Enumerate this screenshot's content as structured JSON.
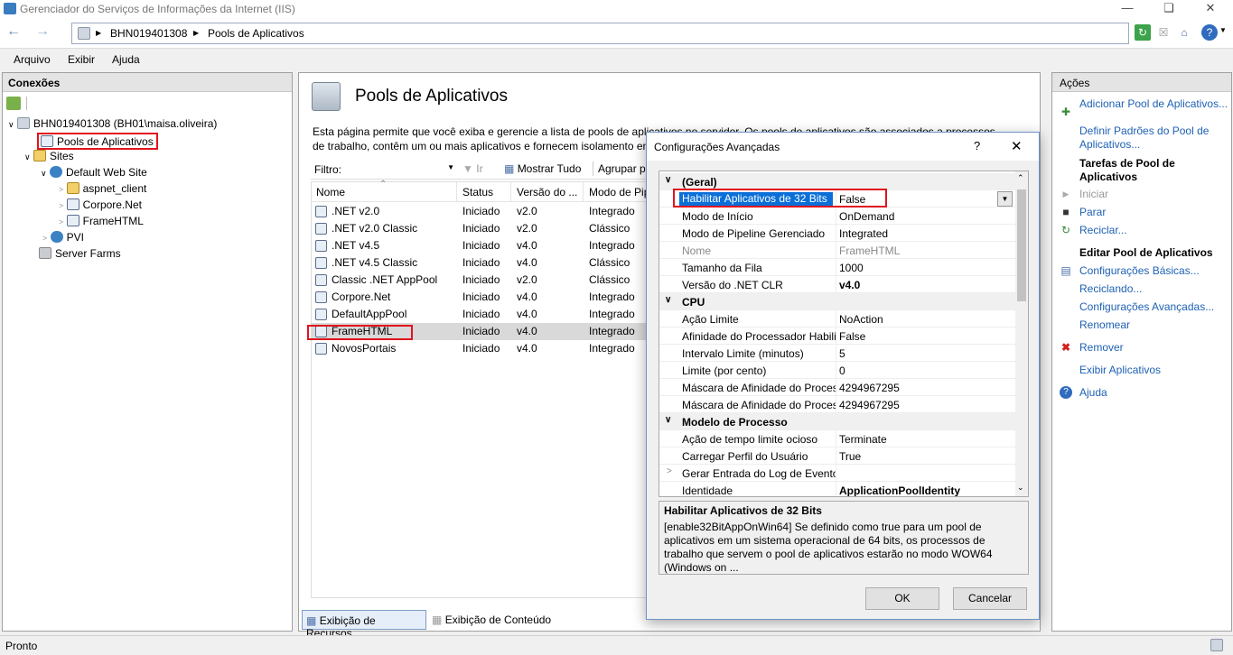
{
  "window": {
    "title": "Gerenciador do Serviços de Informações da Internet (IIS)"
  },
  "address": {
    "server": "BHN019401308",
    "page": "Pools de Aplicativos"
  },
  "menu": [
    "Arquivo",
    "Exibir",
    "Ajuda"
  ],
  "connections": {
    "title": "Conexões",
    "tree": [
      {
        "label": "BHN019401308 (BH01\\maisa.oliveira)"
      },
      {
        "label": "Pools de Aplicativos"
      },
      {
        "label": "Sites"
      },
      {
        "label": "Default Web Site"
      },
      {
        "label": "aspnet_client"
      },
      {
        "label": "Corpore.Net"
      },
      {
        "label": "FrameHTML"
      },
      {
        "label": "PVI"
      },
      {
        "label": "Server Farms"
      }
    ]
  },
  "main": {
    "heading": "Pools de Aplicativos",
    "description": "Esta página permite que você exiba e gerencie a lista de pools de aplicativos no servidor. Os pools de aplicativos são associados a processos de trabalho, contêm um ou mais aplicativos e fornecem isolamento entre",
    "filter_label": "Filtro:",
    "go_label": "Ir",
    "show_all_label": "Mostrar Tudo",
    "group_label": "Agrupar po",
    "columns": [
      "Nome",
      "Status",
      "Versão do ...",
      "Modo de Pip"
    ],
    "rows": [
      {
        "name": ".NET v2.0",
        "status": "Iniciado",
        "version": "v2.0",
        "mode": "Integrado"
      },
      {
        "name": ".NET v2.0 Classic",
        "status": "Iniciado",
        "version": "v2.0",
        "mode": "Clássico"
      },
      {
        "name": ".NET v4.5",
        "status": "Iniciado",
        "version": "v4.0",
        "mode": "Integrado"
      },
      {
        "name": ".NET v4.5 Classic",
        "status": "Iniciado",
        "version": "v4.0",
        "mode": "Clássico"
      },
      {
        "name": "Classic .NET AppPool",
        "status": "Iniciado",
        "version": "v2.0",
        "mode": "Clássico"
      },
      {
        "name": "Corpore.Net",
        "status": "Iniciado",
        "version": "v4.0",
        "mode": "Integrado"
      },
      {
        "name": "DefaultAppPool",
        "status": "Iniciado",
        "version": "v4.0",
        "mode": "Integrado"
      },
      {
        "name": "FrameHTML",
        "status": "Iniciado",
        "version": "v4.0",
        "mode": "Integrado"
      },
      {
        "name": "NovosPortais",
        "status": "Iniciado",
        "version": "v4.0",
        "mode": "Integrado"
      }
    ],
    "view_tabs": [
      "Exibição de Recursos",
      "Exibição de Conteúdo"
    ]
  },
  "actions": {
    "title": "Ações",
    "add_pool": "Adicionar Pool de Aplicativos...",
    "set_defaults": "Definir Padrões do Pool de Aplicativos...",
    "tasks_heading": "Tarefas de Pool de Aplicativos",
    "start": "Iniciar",
    "stop": "Parar",
    "recycle": "Reciclar...",
    "edit_heading": "Editar Pool de Aplicativos",
    "basic": "Configurações Básicas...",
    "recycling": "Reciclando...",
    "advanced": "Configurações Avançadas...",
    "rename": "Renomear",
    "remove": "Remover",
    "view_apps": "Exibir Aplicativos",
    "help": "Ajuda"
  },
  "status": {
    "text": "Pronto"
  },
  "dialog": {
    "title": "Configurações Avançadas",
    "help_glyph": "?",
    "rows": [
      {
        "type": "cat",
        "name": "(Geral)",
        "value": ""
      },
      {
        "type": "prop",
        "name": "Habilitar Aplicativos de 32 Bits",
        "value": "False"
      },
      {
        "type": "prop",
        "name": "Modo de Início",
        "value": "OnDemand"
      },
      {
        "type": "prop",
        "name": "Modo de Pipeline Gerenciado",
        "value": "Integrated"
      },
      {
        "type": "prop",
        "name": "Nome",
        "value": "FrameHTML"
      },
      {
        "type": "prop",
        "name": "Tamanho da Fila",
        "value": "1000"
      },
      {
        "type": "prop",
        "name": "Versão do .NET CLR",
        "value": "v4.0"
      },
      {
        "type": "cat",
        "name": "CPU",
        "value": ""
      },
      {
        "type": "prop",
        "name": "Ação Limite",
        "value": "NoAction"
      },
      {
        "type": "prop",
        "name": "Afinidade do Processador Habili",
        "value": "False"
      },
      {
        "type": "prop",
        "name": "Intervalo Limite (minutos)",
        "value": "5"
      },
      {
        "type": "prop",
        "name": "Limite (por cento)",
        "value": "0"
      },
      {
        "type": "prop",
        "name": "Máscara de Afinidade do Proces",
        "value": "4294967295"
      },
      {
        "type": "prop",
        "name": "Máscara de Afinidade do Proces",
        "value": "4294967295"
      },
      {
        "type": "cat",
        "name": "Modelo de Processo",
        "value": ""
      },
      {
        "type": "prop",
        "name": "Ação de tempo limite ocioso",
        "value": "Terminate"
      },
      {
        "type": "prop",
        "name": "Carregar Perfil do Usuário",
        "value": "True"
      },
      {
        "type": "prop",
        "name": "Gerar Entrada do Log de Eventos",
        "value": ""
      },
      {
        "type": "prop",
        "name": "Identidade",
        "value": "ApplicationPoolIdentity"
      }
    ],
    "desc_title": "Habilitar Aplicativos de 32 Bits",
    "desc_text": "[enable32BitAppOnWin64] Se definido como true para um pool de aplicativos em um sistema operacional de 64 bits, os processos de trabalho que servem o pool de aplicativos estarão no modo WOW64 (Windows on ...",
    "ok": "OK",
    "cancel": "Cancelar"
  }
}
